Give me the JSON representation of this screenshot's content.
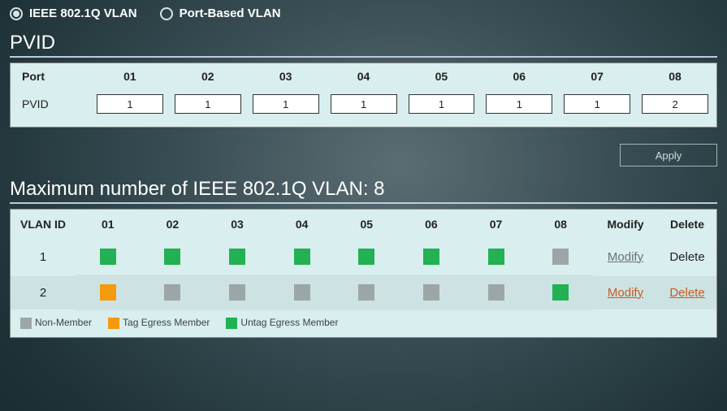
{
  "mode": {
    "ieee_label": "IEEE 802.1Q VLAN",
    "port_label": "Port-Based VLAN",
    "selected": "ieee"
  },
  "pvid": {
    "title": "PVID",
    "port_header": "Port",
    "row_label": "PVID",
    "ports": [
      "01",
      "02",
      "03",
      "04",
      "05",
      "06",
      "07",
      "08"
    ],
    "values": [
      "1",
      "1",
      "1",
      "1",
      "1",
      "1",
      "1",
      "2"
    ]
  },
  "apply_label": "Apply",
  "vlan_section": {
    "title": "Maximum number of IEEE 802.1Q VLAN: 8",
    "headers": {
      "vlan_id": "VLAN ID",
      "ports": [
        "01",
        "02",
        "03",
        "04",
        "05",
        "06",
        "07",
        "08"
      ],
      "modify": "Modify",
      "delete": "Delete"
    },
    "rows": [
      {
        "id": "1",
        "members": [
          "untag",
          "untag",
          "untag",
          "untag",
          "untag",
          "untag",
          "untag",
          "non"
        ],
        "modify_label": "Modify",
        "delete_label": "Delete",
        "delete_enabled": false,
        "modify_style": "gray"
      },
      {
        "id": "2",
        "members": [
          "tag",
          "non",
          "non",
          "non",
          "non",
          "non",
          "non",
          "untag"
        ],
        "modify_label": "Modify",
        "delete_label": "Delete",
        "delete_enabled": true,
        "modify_style": "orange"
      }
    ],
    "legend": {
      "non": "Non-Member",
      "tag": "Tag Egress Member",
      "untag": "Untag Egress Member"
    }
  }
}
